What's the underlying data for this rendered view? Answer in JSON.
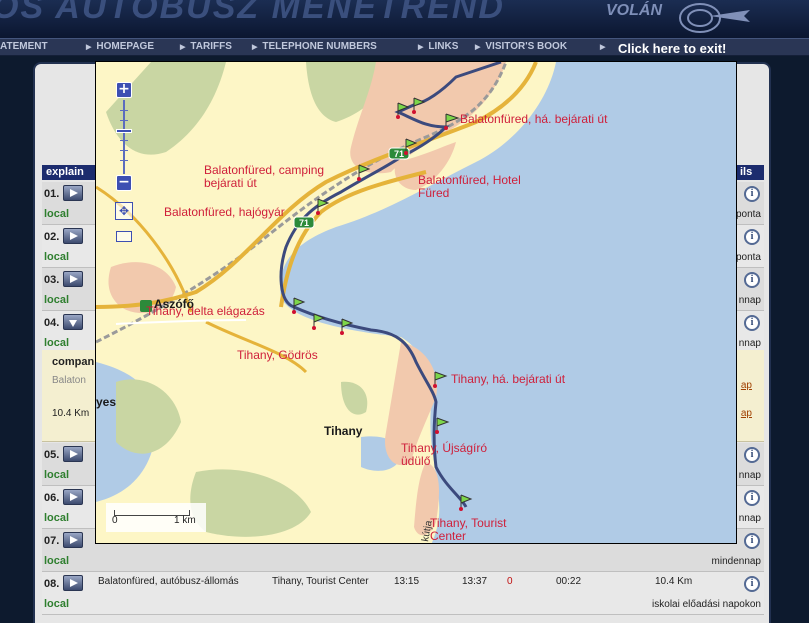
{
  "header": {
    "title": "OS AUTÓBUSZ MENETREND",
    "logo_text": "VOLÁN",
    "nav": [
      "ATEMENT",
      "HOMEPAGE",
      "TARIFFS",
      "TELEPHONE NUMBERS",
      "LINKS",
      "VISITOR'S BOOK",
      ""
    ],
    "exit_link": "Click here to exit!"
  },
  "table": {
    "left_header": "explain",
    "right_header": "ils",
    "rows": [
      {
        "num": "01.",
        "type": "local",
        "tag": "ponta",
        "expanded": false
      },
      {
        "num": "02.",
        "type": "local",
        "tag": "ponta",
        "expanded": false
      },
      {
        "num": "03.",
        "type": "local",
        "tag": "nnap",
        "expanded": false
      },
      {
        "num": "04.",
        "type": "local",
        "tag": "nnap",
        "expanded": true
      },
      {
        "num": "05.",
        "type": "local",
        "tag": "nnap",
        "expanded": false
      },
      {
        "num": "06.",
        "type": "local",
        "tag": "nnap",
        "expanded": false
      },
      {
        "num": "07.",
        "type": "local",
        "tag": "mindennap",
        "expanded": false
      },
      {
        "num": "08.",
        "type": "local",
        "tag": "iskolai előadási napokon",
        "expanded": false
      }
    ],
    "row8_cells": {
      "from": "Balatonfüred, autóbusz-állomás",
      "to": "Tihany, Tourist Center",
      "dep": "13:15",
      "arr": "13:37",
      "zero": "0",
      "dur": "00:22",
      "km": "10.4 Km"
    },
    "detail": {
      "header": "compan",
      "stop": "Balaton",
      "km": "10.4 Km",
      "link1": "ap",
      "link2": "ap"
    },
    "info_glyph": "i"
  },
  "map": {
    "zoom_in": "+",
    "zoom_out": "−",
    "pan_glyph": "✥",
    "labels": [
      "Balatonfüred, há. bejárati út",
      "Balatonfüred, camping bejárati út",
      "Balatonfüred, Hotel Füred",
      "Balatonfüred, hajógyár",
      "Tihany, delta elágazás",
      "Tihany, Gödrös",
      "Tihany, há. bejárati út",
      "Tihany, Újságíró üdülő",
      "Tihany, Tourist Center"
    ],
    "towns": [
      "Aszófő",
      "Tihany",
      "yes"
    ],
    "road_badge": "71",
    "road_badge2": "71",
    "side_street": "kútja",
    "scale": {
      "start": "0",
      "end": "1 km"
    }
  },
  "colors": {
    "water": "#b0cbe6",
    "land": "#fdf6c6",
    "urban": "#f2c9ad",
    "route": "#3c4a7d",
    "label": "#cf1f3a"
  }
}
